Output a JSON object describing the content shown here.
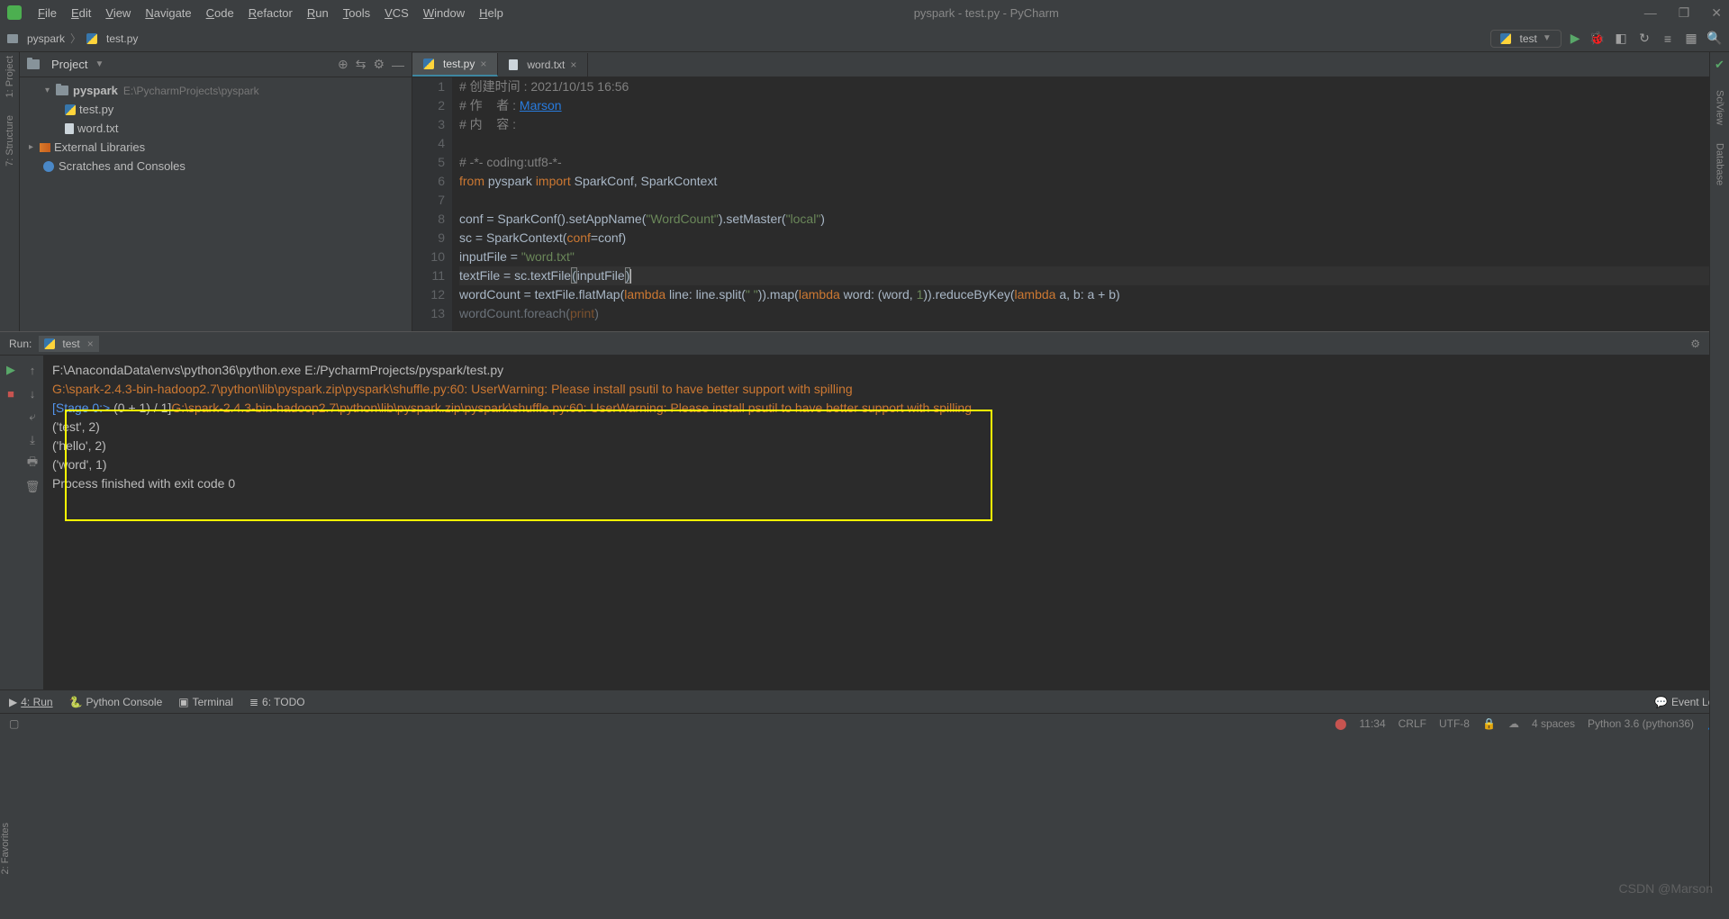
{
  "window": {
    "title": "pyspark - test.py - PyCharm",
    "minimize": "—",
    "maximize": "❐",
    "close": "✕"
  },
  "menu": [
    "File",
    "Edit",
    "View",
    "Navigate",
    "Code",
    "Refactor",
    "Run",
    "Tools",
    "VCS",
    "Window",
    "Help"
  ],
  "breadcrumb": {
    "root": "pyspark",
    "file": "test.py"
  },
  "runconfig": {
    "name": "test"
  },
  "projectPanel": {
    "title": "Project",
    "root": {
      "name": "pyspark",
      "path": "E:\\PycharmProjects\\pyspark"
    },
    "files": [
      {
        "name": "test.py",
        "type": "py"
      },
      {
        "name": "word.txt",
        "type": "txt"
      }
    ],
    "extlib": "External Libraries",
    "scratches": "Scratches and Consoles"
  },
  "tabs": [
    {
      "label": "test.py",
      "active": true,
      "type": "py"
    },
    {
      "label": "word.txt",
      "active": false,
      "type": "txt"
    }
  ],
  "code": {
    "lines": [
      {
        "n": 1,
        "html": "<span class='cm'># 创建时间 : 2021/10/15 16:56</span>"
      },
      {
        "n": 2,
        "html": "<span class='cm'># 作    者 : </span><span class='link'>Marson</span>"
      },
      {
        "n": 3,
        "html": "<span class='cm'># 内    容 :</span>"
      },
      {
        "n": 4,
        "html": ""
      },
      {
        "n": 5,
        "html": "<span class='cm'># -*- coding:utf8-*-</span>"
      },
      {
        "n": 6,
        "html": "<span class='kw'>from</span> pyspark <span class='kw'>import</span> SparkConf, SparkContext"
      },
      {
        "n": 7,
        "html": ""
      },
      {
        "n": 8,
        "html": "conf = SparkConf().setAppName(<span class='str'>\"WordCount\"</span>).setMaster(<span class='str'>\"local\"</span>)"
      },
      {
        "n": 9,
        "html": "sc = SparkContext(<span class='kw'>conf</span>=conf)"
      },
      {
        "n": 10,
        "html": "inputFile = <span class='str'>\"word.txt\"</span>"
      },
      {
        "n": 11,
        "html": "textFile = sc.textFile<span class='par-match'>(</span>inputFile<span class='par-match'>)</span><span class='cursor'></span>",
        "current": true
      },
      {
        "n": 12,
        "html": "wordCount = textFile.flatMap(<span class='kw'>lambda</span> line: line.split(<span class='str'>\" \"</span>)).map(<span class='kw'>lambda</span> word: (word, <span class='str'>1</span>)).reduceByKey(<span class='kw'>lambda</span> a, b: a + b)"
      },
      {
        "n": 13,
        "html": "<span style='opacity:.5'>wordCount.foreach(<span class=\"kw\">print</span>)</span>"
      }
    ]
  },
  "run": {
    "label": "Run:",
    "tab": "test",
    "lines": [
      {
        "text": "F:\\AnacondaData\\envs\\python36\\python.exe E:/PycharmProjects/pyspark/test.py"
      },
      {
        "cls": "warn",
        "text": "G:\\spark-2.4.3-bin-hadoop2.7\\python\\lib\\pyspark.zip\\pyspark\\shuffle.py:60: UserWarning: Please install psutil to have better support with spilling"
      },
      {
        "html": "<span class='stage'>[Stage 0:></span>                                                          (0 + 1) / 1]<span class='warn'>G:\\spark-2.4.3-bin-hadoop2.7\\python\\lib\\pyspark.zip\\pyspark\\shuffle.py:60: UserWarning: Please install psutil to have better support with spilling</span>"
      },
      {
        "text": "('test', 2)"
      },
      {
        "text": "('hello', 2)"
      },
      {
        "text": "('word', 1)"
      },
      {
        "text": ""
      },
      {
        "text": "Process finished with exit code 0"
      }
    ]
  },
  "bottomTabs": [
    "4: Run",
    "Python Console",
    "Terminal",
    "6: TODO"
  ],
  "eventLog": "Event Log",
  "status": {
    "pos": "11:34",
    "sep": "CRLF",
    "enc": "UTF-8",
    "indent": "4 spaces",
    "sdk": "Python 3.6 (python36)"
  },
  "sideRailsLeft": [
    "1: Project",
    "7: Structure"
  ],
  "sideRailsLeftBottom": "2: Favorites",
  "sideRailsRight": [
    "SciView",
    "Database"
  ],
  "watermark": "CSDN @Marson"
}
